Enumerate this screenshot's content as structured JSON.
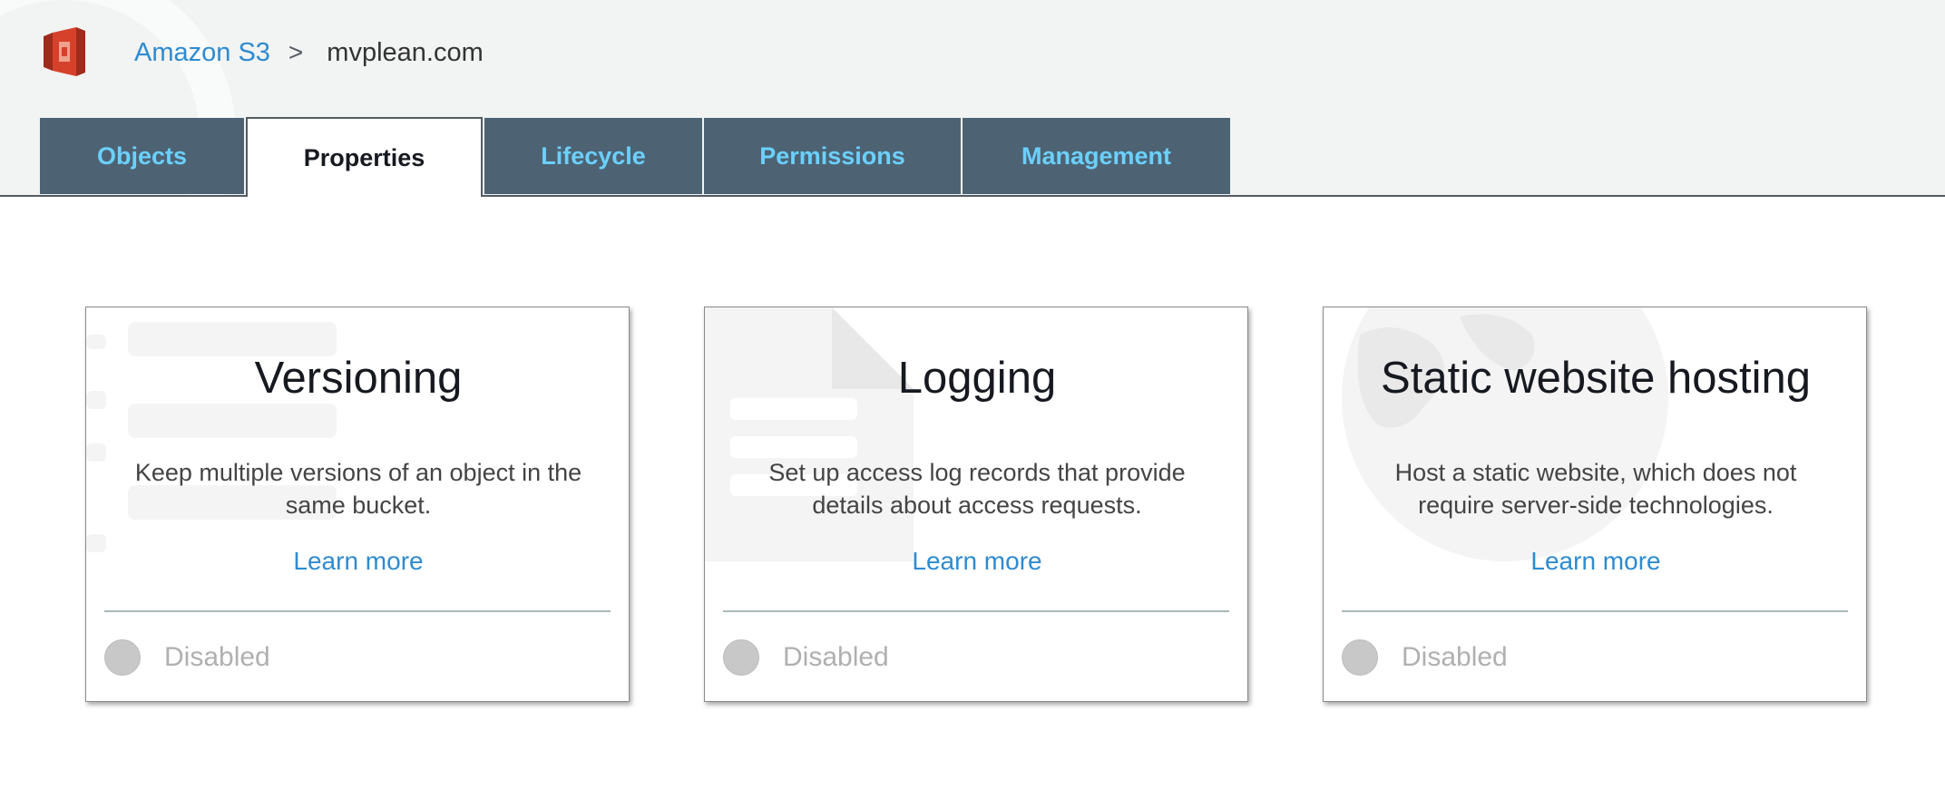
{
  "header": {
    "logo_icon": "amazon-s3-bucket-icon",
    "breadcrumb": {
      "service": "Amazon S3",
      "separator": ">",
      "bucket": "mvplean.com"
    }
  },
  "tabs": [
    {
      "label": "Objects",
      "active": false
    },
    {
      "label": "Properties",
      "active": true
    },
    {
      "label": "Lifecycle",
      "active": false
    },
    {
      "label": "Permissions",
      "active": false
    },
    {
      "label": "Management",
      "active": false
    }
  ],
  "cards": [
    {
      "title": "Versioning",
      "description": "Keep multiple versions of an object in the same bucket.",
      "link": "Learn more",
      "status": "Disabled",
      "icon": "versioning-list-icon"
    },
    {
      "title": "Logging",
      "description": "Set up access log records that provide details about access requests.",
      "link": "Learn more",
      "status": "Disabled",
      "icon": "document-log-icon"
    },
    {
      "title": "Static website hosting",
      "description": "Host a static website, which does not require server-side technologies.",
      "link": "Learn more",
      "status": "Disabled",
      "icon": "globe-icon"
    }
  ],
  "colors": {
    "tab_bg": "#4d6373",
    "tab_text": "#6bd0ff",
    "link": "#2e8bd0",
    "logo": "#d6412b"
  }
}
